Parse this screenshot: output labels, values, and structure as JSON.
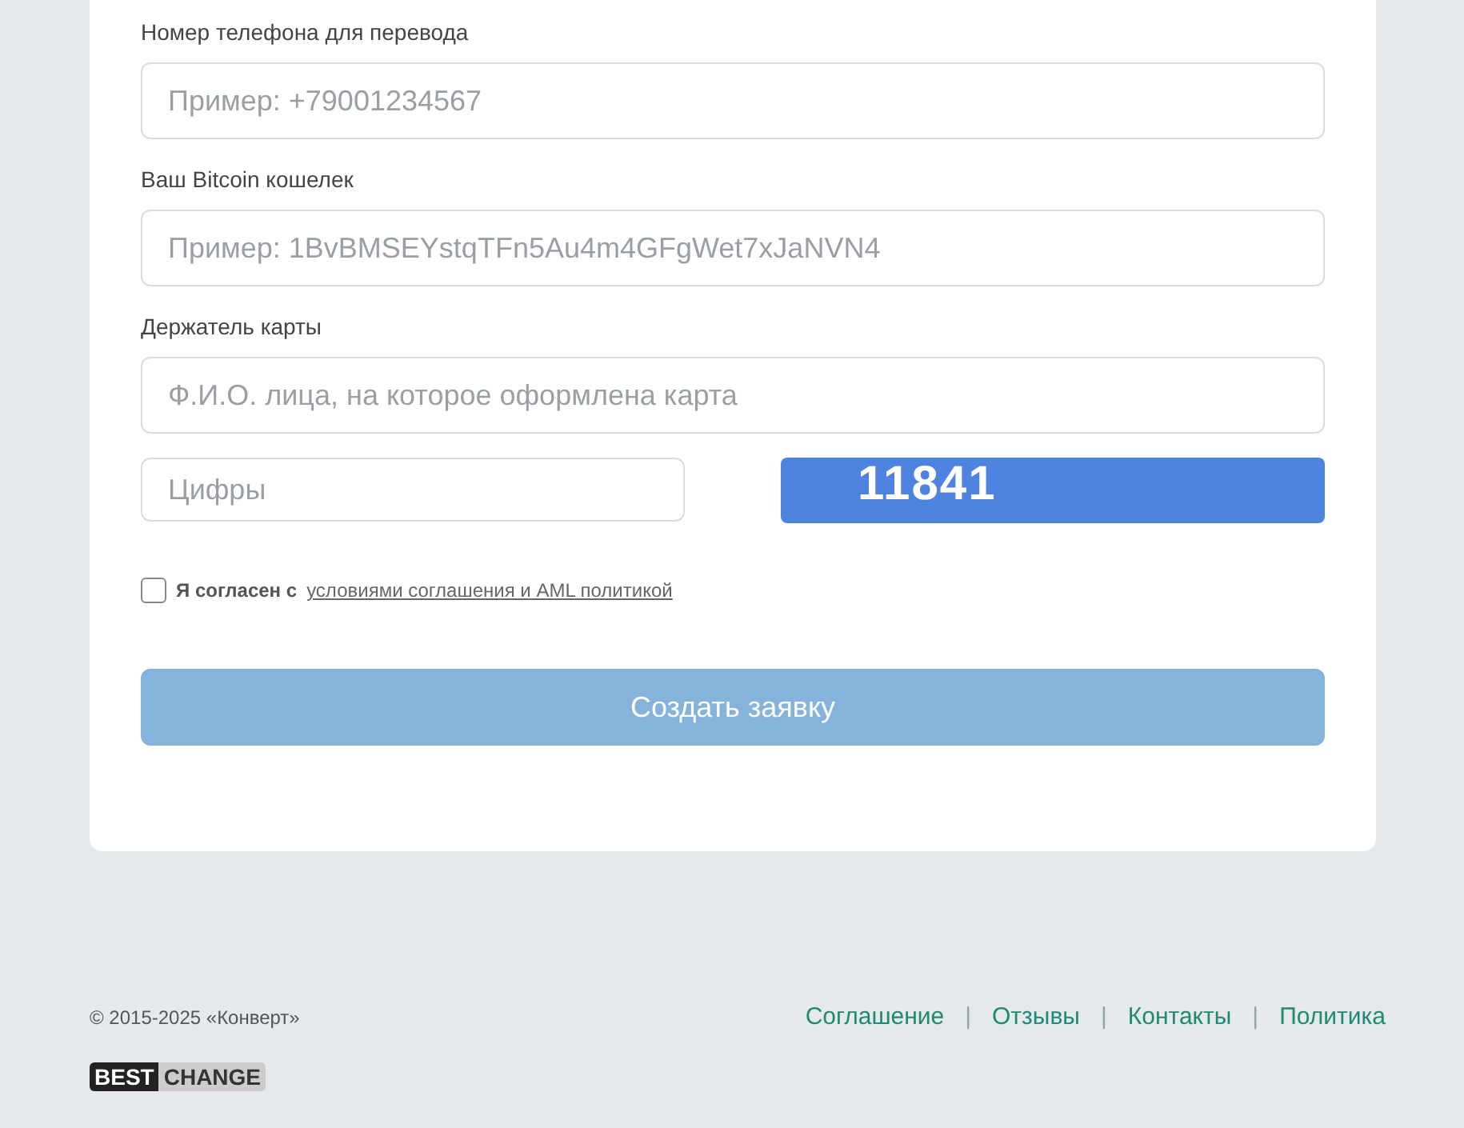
{
  "form": {
    "fields": [
      {
        "label": "Номер телефона для перевода",
        "placeholder": "Пример: +79001234567"
      },
      {
        "label": "Ваш Bitcoin кошелек",
        "placeholder": "Пример: 1BvBMSEYstqTFn5Au4m4GFgWet7xJaNVN4"
      },
      {
        "label": "Держатель карты",
        "placeholder": "Ф.И.О. лица, на которое оформлена карта"
      }
    ],
    "captcha": {
      "placeholder": "Цифры",
      "code": "11841"
    },
    "agreement": {
      "checked": false,
      "text": "Я согласен с",
      "link": "условиями соглашения и AML политикой"
    },
    "submit": {
      "label": "Создать заявку",
      "disabled": true
    }
  },
  "footer": {
    "copyright": "© 2015-2025 «Конверт»",
    "links": [
      "Соглашение",
      "Отзывы",
      "Контакты",
      "Политика"
    ],
    "separators": [
      "|",
      "|",
      "|"
    ],
    "logo": {
      "part_1": "BEST",
      "part_2": "CHANGE"
    }
  }
}
